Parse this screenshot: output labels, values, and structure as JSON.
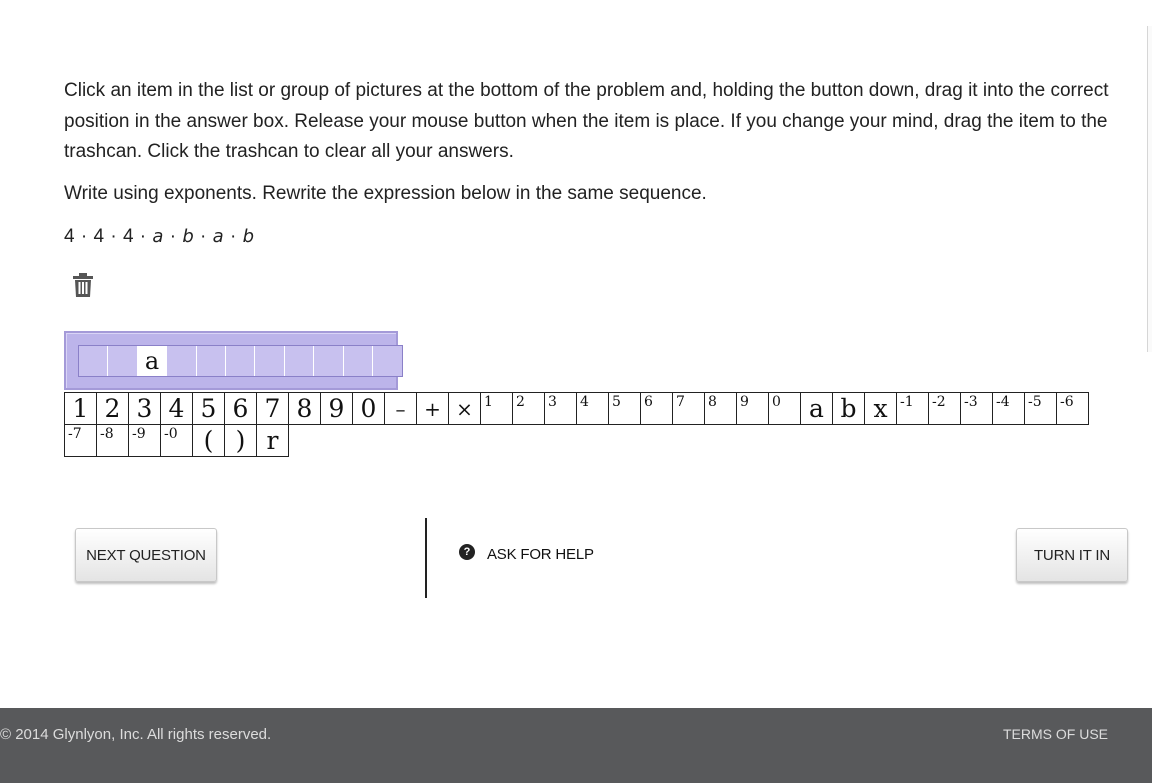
{
  "instructions": "Click an item in the list or group of pictures at the bottom of the problem and, holding the button down, drag it into the correct position in the answer box. Release your mouse button when the item is place. If you change your mind, drag the item to the trashcan. Click the trashcan to clear all your answers.",
  "prompt": "Write using exponents. Rewrite the expression below in the same sequence.",
  "expression": {
    "n1": "4",
    "n2": "4",
    "n3": "4",
    "v1": "a",
    "v2": "b",
    "v3": "a",
    "v4": "b",
    "dot": "·"
  },
  "trash_icon": "trash-icon",
  "answer_slots": [
    "",
    "",
    "a",
    "",
    "",
    "",
    "",
    "",
    "",
    "",
    ""
  ],
  "tiles_row1": [
    {
      "label": "1",
      "kind": "big"
    },
    {
      "label": "2",
      "kind": "big"
    },
    {
      "label": "3",
      "kind": "big"
    },
    {
      "label": "4",
      "kind": "big"
    },
    {
      "label": "5",
      "kind": "big"
    },
    {
      "label": "6",
      "kind": "big"
    },
    {
      "label": "7",
      "kind": "big"
    },
    {
      "label": "8",
      "kind": "big"
    },
    {
      "label": "9",
      "kind": "big"
    },
    {
      "label": "0",
      "kind": "big"
    },
    {
      "label": "–",
      "kind": "op"
    },
    {
      "label": "+",
      "kind": "op"
    },
    {
      "label": "×",
      "kind": "op"
    },
    {
      "label": "1",
      "kind": "sup"
    },
    {
      "label": "2",
      "kind": "sup"
    },
    {
      "label": "3",
      "kind": "sup"
    },
    {
      "label": "4",
      "kind": "sup"
    },
    {
      "label": "5",
      "kind": "sup"
    },
    {
      "label": "6",
      "kind": "sup"
    },
    {
      "label": "7",
      "kind": "sup"
    },
    {
      "label": "8",
      "kind": "sup"
    },
    {
      "label": "9",
      "kind": "sup"
    },
    {
      "label": "0",
      "kind": "sup"
    },
    {
      "label": "a",
      "kind": "big"
    },
    {
      "label": "b",
      "kind": "big"
    },
    {
      "label": "x",
      "kind": "big"
    },
    {
      "label": "-1",
      "kind": "sup"
    },
    {
      "label": "-2",
      "kind": "sup"
    },
    {
      "label": "-3",
      "kind": "sup"
    },
    {
      "label": "-4",
      "kind": "sup"
    },
    {
      "label": "-5",
      "kind": "sup"
    },
    {
      "label": "-6",
      "kind": "sup"
    }
  ],
  "tiles_row2": [
    {
      "label": "-7",
      "kind": "sup"
    },
    {
      "label": "-8",
      "kind": "sup"
    },
    {
      "label": "-9",
      "kind": "sup"
    },
    {
      "label": "-0",
      "kind": "sup"
    },
    {
      "label": "(",
      "kind": "big"
    },
    {
      "label": ")",
      "kind": "big"
    },
    {
      "label": "r",
      "kind": "big"
    }
  ],
  "buttons": {
    "next_question": "NEXT QUESTION",
    "ask_for_help": "ASK FOR HELP",
    "help_icon_glyph": "?",
    "turn_it_in": "TURN IT IN"
  },
  "footer": {
    "copyright": "© 2014 Glynlyon, Inc. All rights reserved.",
    "terms": "TERMS OF USE"
  },
  "colors": {
    "answer_box": "#bcb4ea",
    "footer_bg": "#58595b"
  }
}
